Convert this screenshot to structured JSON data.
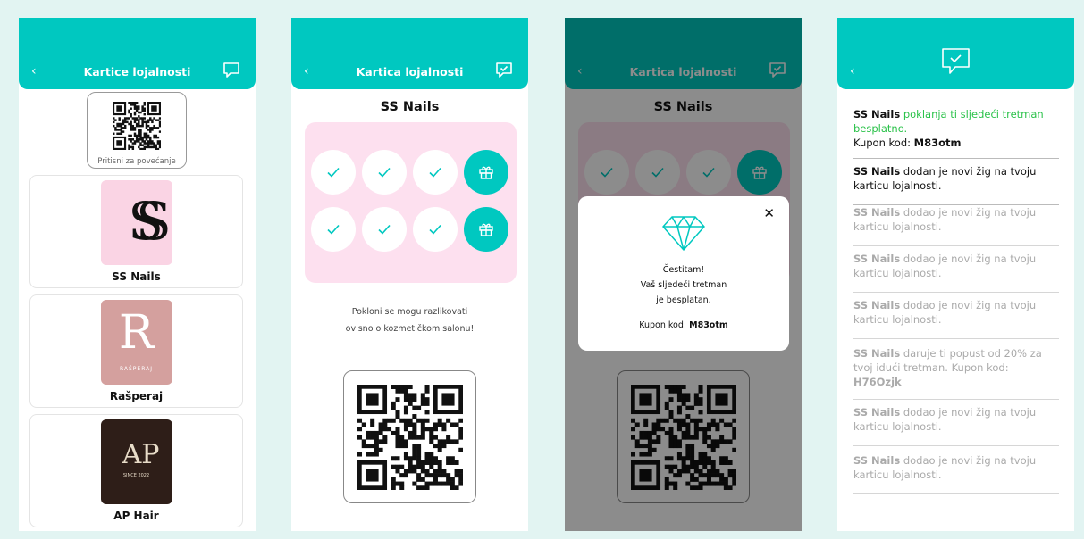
{
  "colors": {
    "accent": "#00c8c0",
    "pink": "#fde0ef",
    "green": "#2bc24a"
  },
  "screen1": {
    "title": "Kartice lojalnosti",
    "back": "‹",
    "qr_caption": "Pritisni za povećanje",
    "cards": [
      {
        "name": "SS Nails",
        "logo_text": "SS"
      },
      {
        "name": "Rašperaj",
        "logo_text": "R",
        "logo_sub": "RAŠPERAJ"
      },
      {
        "name": "AP Hair",
        "logo_text": "AP",
        "logo_sub": "SINCE 2022"
      }
    ]
  },
  "screen2": {
    "title": "Kartica lojalnosti",
    "back": "‹",
    "brand": "SS Nails",
    "stamps": [
      "check",
      "check",
      "check",
      "gift",
      "check",
      "check",
      "check",
      "gift"
    ],
    "note": "Pokloni se mogu razlikovati ovisno o kozmetičkom salonu!"
  },
  "screen3": {
    "title": "Kartica lojalnosti",
    "back": "‹",
    "brand": "SS Nails",
    "modal": {
      "close": "✕",
      "line1": "Čestitam!",
      "line2": "Vaš sljedeći tretman",
      "line3": "je besplatan.",
      "kod_label": "Kupon kod:",
      "kod_value": "M83otm"
    }
  },
  "screen4": {
    "back": "‹",
    "notifications": [
      {
        "brand": "SS Nails",
        "text": " poklanja ti sljedeći tretman besplatno.",
        "kod_label": "Kupon kod: ",
        "kod": "M83otm"
      },
      {
        "brand": "SS Nails",
        "text": " dodan je novi žig na tvoju karticu lojalnosti."
      },
      {
        "brand": "SS Nails",
        "text": " dodao je novi žig na tvoju karticu lojalnosti."
      },
      {
        "brand": "SS Nails",
        "text": " dodao je novi žig na tvoju karticu lojalnosti."
      },
      {
        "brand": "SS Nails",
        "text": " dodao je novi žig na tvoju karticu lojalnosti."
      },
      {
        "brand": "SS Nails",
        "text": " daruje ti popust od 20% za tvoj idući tretman. Kupon kod: ",
        "kod": "H76Ozjk"
      },
      {
        "brand": "SS Nails",
        "text": " dodao je novi žig na tvoju karticu lojalnosti."
      },
      {
        "brand": "SS Nails",
        "text": " dodao je novi žig na tvoju karticu lojalnosti."
      }
    ]
  }
}
